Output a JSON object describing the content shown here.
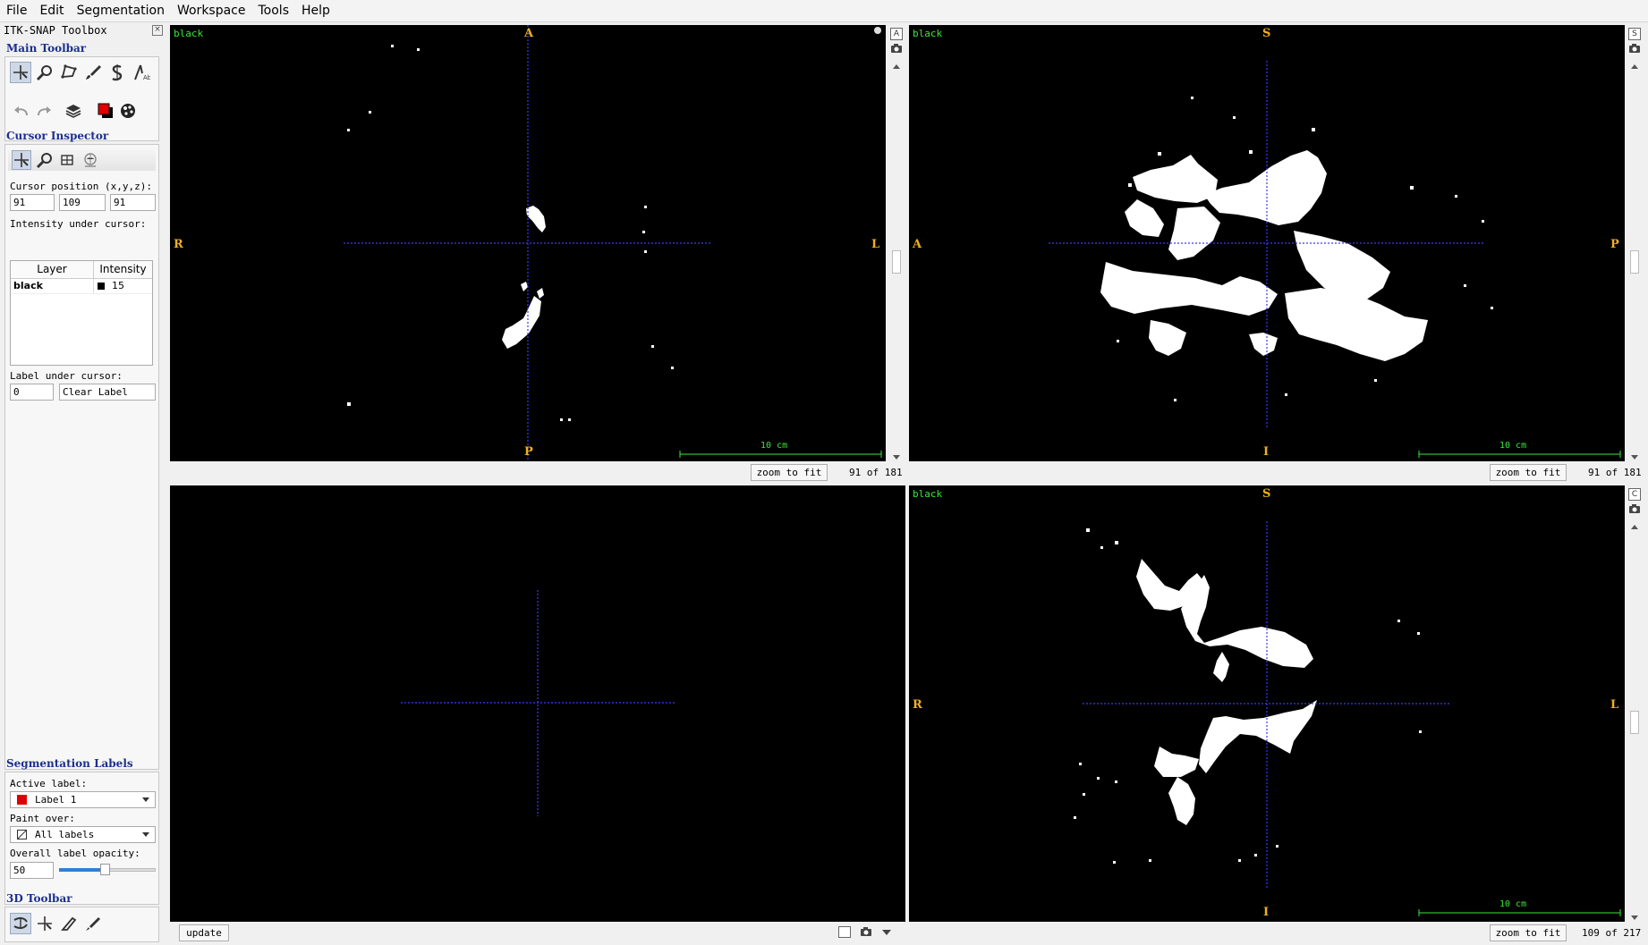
{
  "menu": [
    "File",
    "Edit",
    "Segmentation",
    "Workspace",
    "Tools",
    "Help"
  ],
  "toolbox": {
    "title": "ITK-SNAP Toolbox",
    "main_toolbar": {
      "title": "Main Toolbar",
      "tools": [
        "crosshair-icon",
        "zoom-icon",
        "polygon-icon",
        "paintbrush-icon",
        "snake-icon",
        "annotation-icon"
      ],
      "actions": [
        "undo-icon",
        "redo-icon",
        "layers-icon",
        "label-color-icon",
        "palette-icon"
      ]
    },
    "cursor_inspector": {
      "title": "Cursor Inspector",
      "cursor_position_label": "Cursor position (x,y,z):",
      "x": "91",
      "y": "109",
      "z": "91",
      "intensity_label": "Intensity under cursor:",
      "table_headers": [
        "Layer",
        "Intensity"
      ],
      "rows": [
        {
          "layer": "black",
          "intensity": "15"
        }
      ],
      "label_under_cursor_label": "Label under cursor:",
      "label_id": "0",
      "label_name": "Clear Label"
    },
    "segmentation_labels": {
      "title": "Segmentation Labels",
      "active_label_label": "Active label:",
      "active_label": "Label 1",
      "active_label_color": "#e00000",
      "paint_over_label": "Paint over:",
      "paint_over": "All labels",
      "opacity_label": "Overall label opacity:",
      "opacity": "50"
    },
    "toolbar_3d": {
      "title": "3D Toolbar",
      "tools": [
        "rotate-icon",
        "crosshair-3d-icon",
        "scalpel-icon",
        "spray-icon"
      ]
    }
  },
  "views": {
    "axial": {
      "layer": "black",
      "top": "A",
      "bottom": "P",
      "left": "R",
      "right": "L",
      "scale": "10 cm",
      "zoom_button": "zoom to fit",
      "slice": "91 of 181"
    },
    "sagittal": {
      "layer": "black",
      "top": "S",
      "bottom": "I",
      "left": "A",
      "right": "P",
      "scale": "10 cm",
      "zoom_button": "zoom to fit",
      "slice": "91 of 181"
    },
    "three_d": {
      "update_button": "update"
    },
    "coronal": {
      "layer": "black",
      "top": "S",
      "bottom": "I",
      "left": "R",
      "right": "L",
      "scale": "10 cm",
      "zoom_button": "zoom to fit",
      "slice": "109 of 217"
    }
  },
  "colors": {
    "crosshair": "#3a3aff",
    "orientation": "#f0b020",
    "overlay_text": "#38e838",
    "segmentation": "#ffffff"
  }
}
